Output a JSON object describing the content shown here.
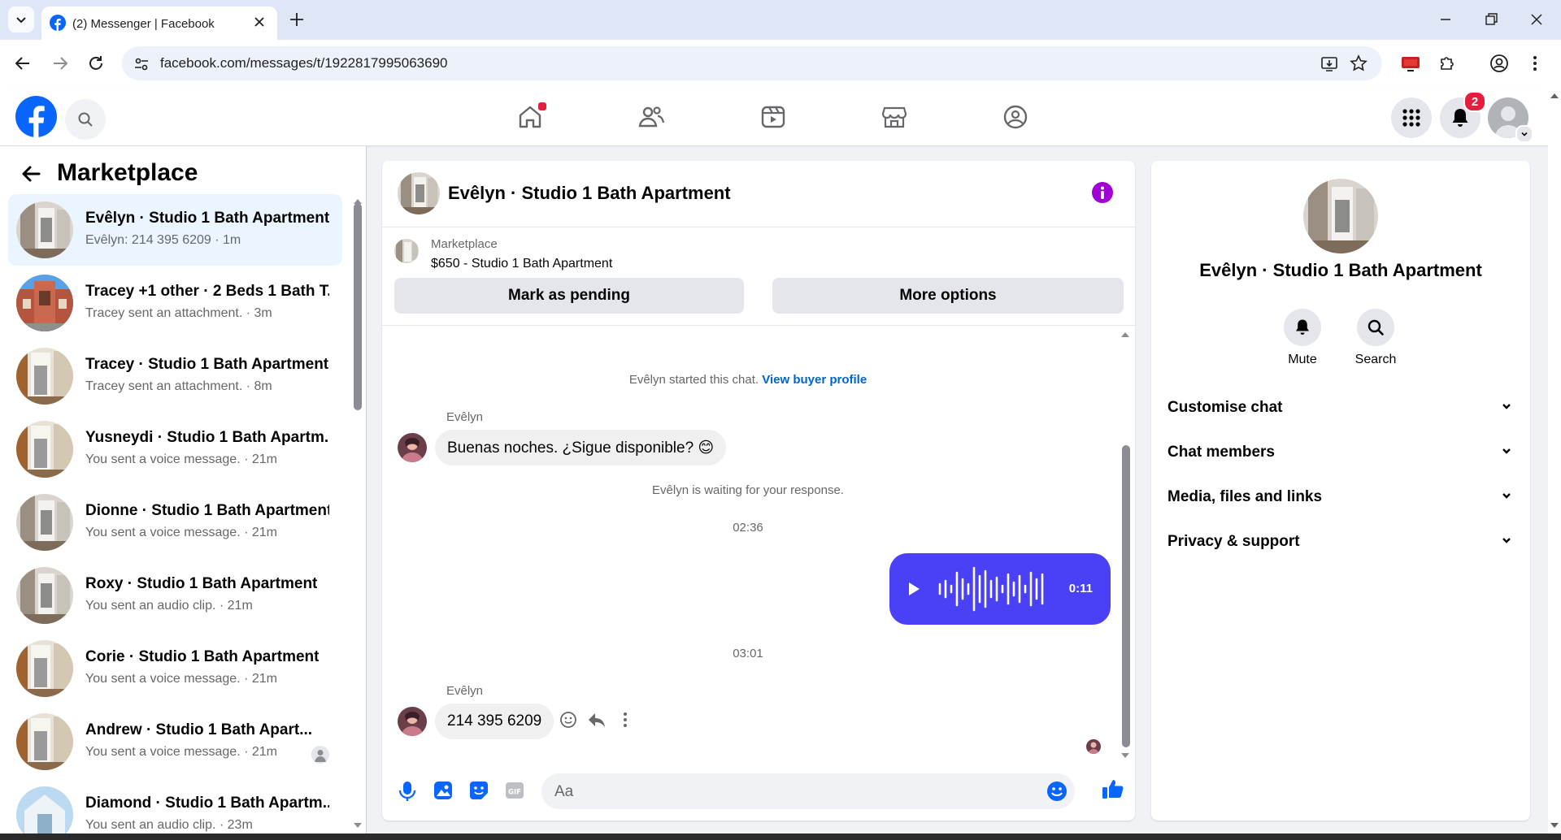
{
  "browser": {
    "tab_title": "(2) Messenger | Facebook",
    "url": "facebook.com/messages/t/1922817995063690"
  },
  "fb_nav": {
    "notification_count": "2",
    "colors": {
      "brand": "#0866ff",
      "badge": "#e41e3f"
    }
  },
  "sidebar": {
    "title": "Marketplace",
    "conversations": [
      {
        "name": "Evêlyn · Studio 1 Bath Apartment",
        "preview": "Evêlyn: 214 395 6209 · 1m",
        "active": true
      },
      {
        "name": "Tracey +1 other · 2 Beds 1 Bath T...",
        "preview": "Tracey sent an attachment. · 3m"
      },
      {
        "name": "Tracey · Studio 1 Bath Apartment",
        "preview": "Tracey sent an attachment. · 8m"
      },
      {
        "name": "Yusneydi · Studio 1 Bath Apartm...",
        "preview": "You sent a voice message. · 21m"
      },
      {
        "name": "Dionne · Studio 1 Bath Apartment",
        "preview": "You sent a voice message. · 21m"
      },
      {
        "name": "Roxy · Studio 1 Bath Apartment",
        "preview": "You sent an audio clip. · 21m"
      },
      {
        "name": "Corie · Studio 1 Bath Apartment",
        "preview": "You sent a voice message. · 21m"
      },
      {
        "name": "Andrew · Studio 1 Bath Apart...",
        "preview": "You sent a voice message. · 21m"
      },
      {
        "name": "Diamond · Studio 1 Bath Apartm...",
        "preview": "You sent an audio clip. · 23m"
      }
    ]
  },
  "chat": {
    "title": "Evêlyn · Studio 1 Bath Apartment",
    "listing": {
      "label": "Marketplace",
      "price_title": "$650 - Studio 1 Bath Apartment",
      "mark_pending": "Mark as pending",
      "more_options": "More options"
    },
    "started_text": "Evêlyn started this chat.",
    "view_profile": "View buyer profile",
    "sender_name": "Evêlyn",
    "message_1": "Buenas noches. ¿Sigue disponible? 😊",
    "waiting_text": "Evêlyn is waiting for your response.",
    "time_1": "02:36",
    "voice_duration": "0:11",
    "time_2": "03:01",
    "message_2": "214 395 6209",
    "composer_placeholder": "Aa",
    "accent_color": "#4a40f5"
  },
  "info_panel": {
    "name": "Evêlyn · Studio 1 Bath Apartment",
    "mute": "Mute",
    "search": "Search",
    "sections": [
      "Customise chat",
      "Chat members",
      "Media, files and links",
      "Privacy & support"
    ]
  }
}
